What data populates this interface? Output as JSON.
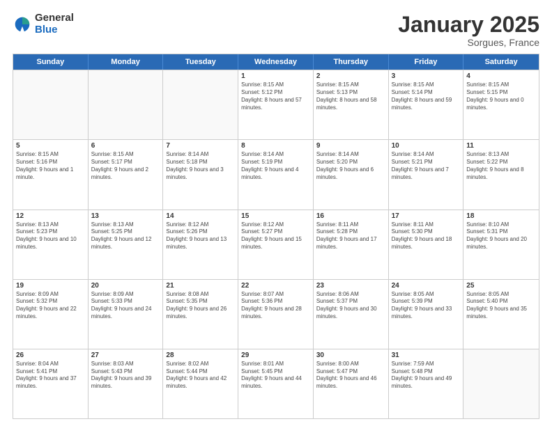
{
  "logo": {
    "general": "General",
    "blue": "Blue"
  },
  "title": "January 2025",
  "location": "Sorgues, France",
  "days_of_week": [
    "Sunday",
    "Monday",
    "Tuesday",
    "Wednesday",
    "Thursday",
    "Friday",
    "Saturday"
  ],
  "weeks": [
    [
      {
        "day": "",
        "empty": true
      },
      {
        "day": "",
        "empty": true
      },
      {
        "day": "",
        "empty": true
      },
      {
        "day": "1",
        "sunrise": "Sunrise: 8:15 AM",
        "sunset": "Sunset: 5:12 PM",
        "daylight": "Daylight: 8 hours and 57 minutes."
      },
      {
        "day": "2",
        "sunrise": "Sunrise: 8:15 AM",
        "sunset": "Sunset: 5:13 PM",
        "daylight": "Daylight: 8 hours and 58 minutes."
      },
      {
        "day": "3",
        "sunrise": "Sunrise: 8:15 AM",
        "sunset": "Sunset: 5:14 PM",
        "daylight": "Daylight: 8 hours and 59 minutes."
      },
      {
        "day": "4",
        "sunrise": "Sunrise: 8:15 AM",
        "sunset": "Sunset: 5:15 PM",
        "daylight": "Daylight: 9 hours and 0 minutes."
      }
    ],
    [
      {
        "day": "5",
        "sunrise": "Sunrise: 8:15 AM",
        "sunset": "Sunset: 5:16 PM",
        "daylight": "Daylight: 9 hours and 1 minute."
      },
      {
        "day": "6",
        "sunrise": "Sunrise: 8:15 AM",
        "sunset": "Sunset: 5:17 PM",
        "daylight": "Daylight: 9 hours and 2 minutes."
      },
      {
        "day": "7",
        "sunrise": "Sunrise: 8:14 AM",
        "sunset": "Sunset: 5:18 PM",
        "daylight": "Daylight: 9 hours and 3 minutes."
      },
      {
        "day": "8",
        "sunrise": "Sunrise: 8:14 AM",
        "sunset": "Sunset: 5:19 PM",
        "daylight": "Daylight: 9 hours and 4 minutes."
      },
      {
        "day": "9",
        "sunrise": "Sunrise: 8:14 AM",
        "sunset": "Sunset: 5:20 PM",
        "daylight": "Daylight: 9 hours and 6 minutes."
      },
      {
        "day": "10",
        "sunrise": "Sunrise: 8:14 AM",
        "sunset": "Sunset: 5:21 PM",
        "daylight": "Daylight: 9 hours and 7 minutes."
      },
      {
        "day": "11",
        "sunrise": "Sunrise: 8:13 AM",
        "sunset": "Sunset: 5:22 PM",
        "daylight": "Daylight: 9 hours and 8 minutes."
      }
    ],
    [
      {
        "day": "12",
        "sunrise": "Sunrise: 8:13 AM",
        "sunset": "Sunset: 5:23 PM",
        "daylight": "Daylight: 9 hours and 10 minutes."
      },
      {
        "day": "13",
        "sunrise": "Sunrise: 8:13 AM",
        "sunset": "Sunset: 5:25 PM",
        "daylight": "Daylight: 9 hours and 12 minutes."
      },
      {
        "day": "14",
        "sunrise": "Sunrise: 8:12 AM",
        "sunset": "Sunset: 5:26 PM",
        "daylight": "Daylight: 9 hours and 13 minutes."
      },
      {
        "day": "15",
        "sunrise": "Sunrise: 8:12 AM",
        "sunset": "Sunset: 5:27 PM",
        "daylight": "Daylight: 9 hours and 15 minutes."
      },
      {
        "day": "16",
        "sunrise": "Sunrise: 8:11 AM",
        "sunset": "Sunset: 5:28 PM",
        "daylight": "Daylight: 9 hours and 17 minutes."
      },
      {
        "day": "17",
        "sunrise": "Sunrise: 8:11 AM",
        "sunset": "Sunset: 5:30 PM",
        "daylight": "Daylight: 9 hours and 18 minutes."
      },
      {
        "day": "18",
        "sunrise": "Sunrise: 8:10 AM",
        "sunset": "Sunset: 5:31 PM",
        "daylight": "Daylight: 9 hours and 20 minutes."
      }
    ],
    [
      {
        "day": "19",
        "sunrise": "Sunrise: 8:09 AM",
        "sunset": "Sunset: 5:32 PM",
        "daylight": "Daylight: 9 hours and 22 minutes."
      },
      {
        "day": "20",
        "sunrise": "Sunrise: 8:09 AM",
        "sunset": "Sunset: 5:33 PM",
        "daylight": "Daylight: 9 hours and 24 minutes."
      },
      {
        "day": "21",
        "sunrise": "Sunrise: 8:08 AM",
        "sunset": "Sunset: 5:35 PM",
        "daylight": "Daylight: 9 hours and 26 minutes."
      },
      {
        "day": "22",
        "sunrise": "Sunrise: 8:07 AM",
        "sunset": "Sunset: 5:36 PM",
        "daylight": "Daylight: 9 hours and 28 minutes."
      },
      {
        "day": "23",
        "sunrise": "Sunrise: 8:06 AM",
        "sunset": "Sunset: 5:37 PM",
        "daylight": "Daylight: 9 hours and 30 minutes."
      },
      {
        "day": "24",
        "sunrise": "Sunrise: 8:05 AM",
        "sunset": "Sunset: 5:39 PM",
        "daylight": "Daylight: 9 hours and 33 minutes."
      },
      {
        "day": "25",
        "sunrise": "Sunrise: 8:05 AM",
        "sunset": "Sunset: 5:40 PM",
        "daylight": "Daylight: 9 hours and 35 minutes."
      }
    ],
    [
      {
        "day": "26",
        "sunrise": "Sunrise: 8:04 AM",
        "sunset": "Sunset: 5:41 PM",
        "daylight": "Daylight: 9 hours and 37 minutes."
      },
      {
        "day": "27",
        "sunrise": "Sunrise: 8:03 AM",
        "sunset": "Sunset: 5:43 PM",
        "daylight": "Daylight: 9 hours and 39 minutes."
      },
      {
        "day": "28",
        "sunrise": "Sunrise: 8:02 AM",
        "sunset": "Sunset: 5:44 PM",
        "daylight": "Daylight: 9 hours and 42 minutes."
      },
      {
        "day": "29",
        "sunrise": "Sunrise: 8:01 AM",
        "sunset": "Sunset: 5:45 PM",
        "daylight": "Daylight: 9 hours and 44 minutes."
      },
      {
        "day": "30",
        "sunrise": "Sunrise: 8:00 AM",
        "sunset": "Sunset: 5:47 PM",
        "daylight": "Daylight: 9 hours and 46 minutes."
      },
      {
        "day": "31",
        "sunrise": "Sunrise: 7:59 AM",
        "sunset": "Sunset: 5:48 PM",
        "daylight": "Daylight: 9 hours and 49 minutes."
      },
      {
        "day": "",
        "empty": true
      }
    ]
  ]
}
